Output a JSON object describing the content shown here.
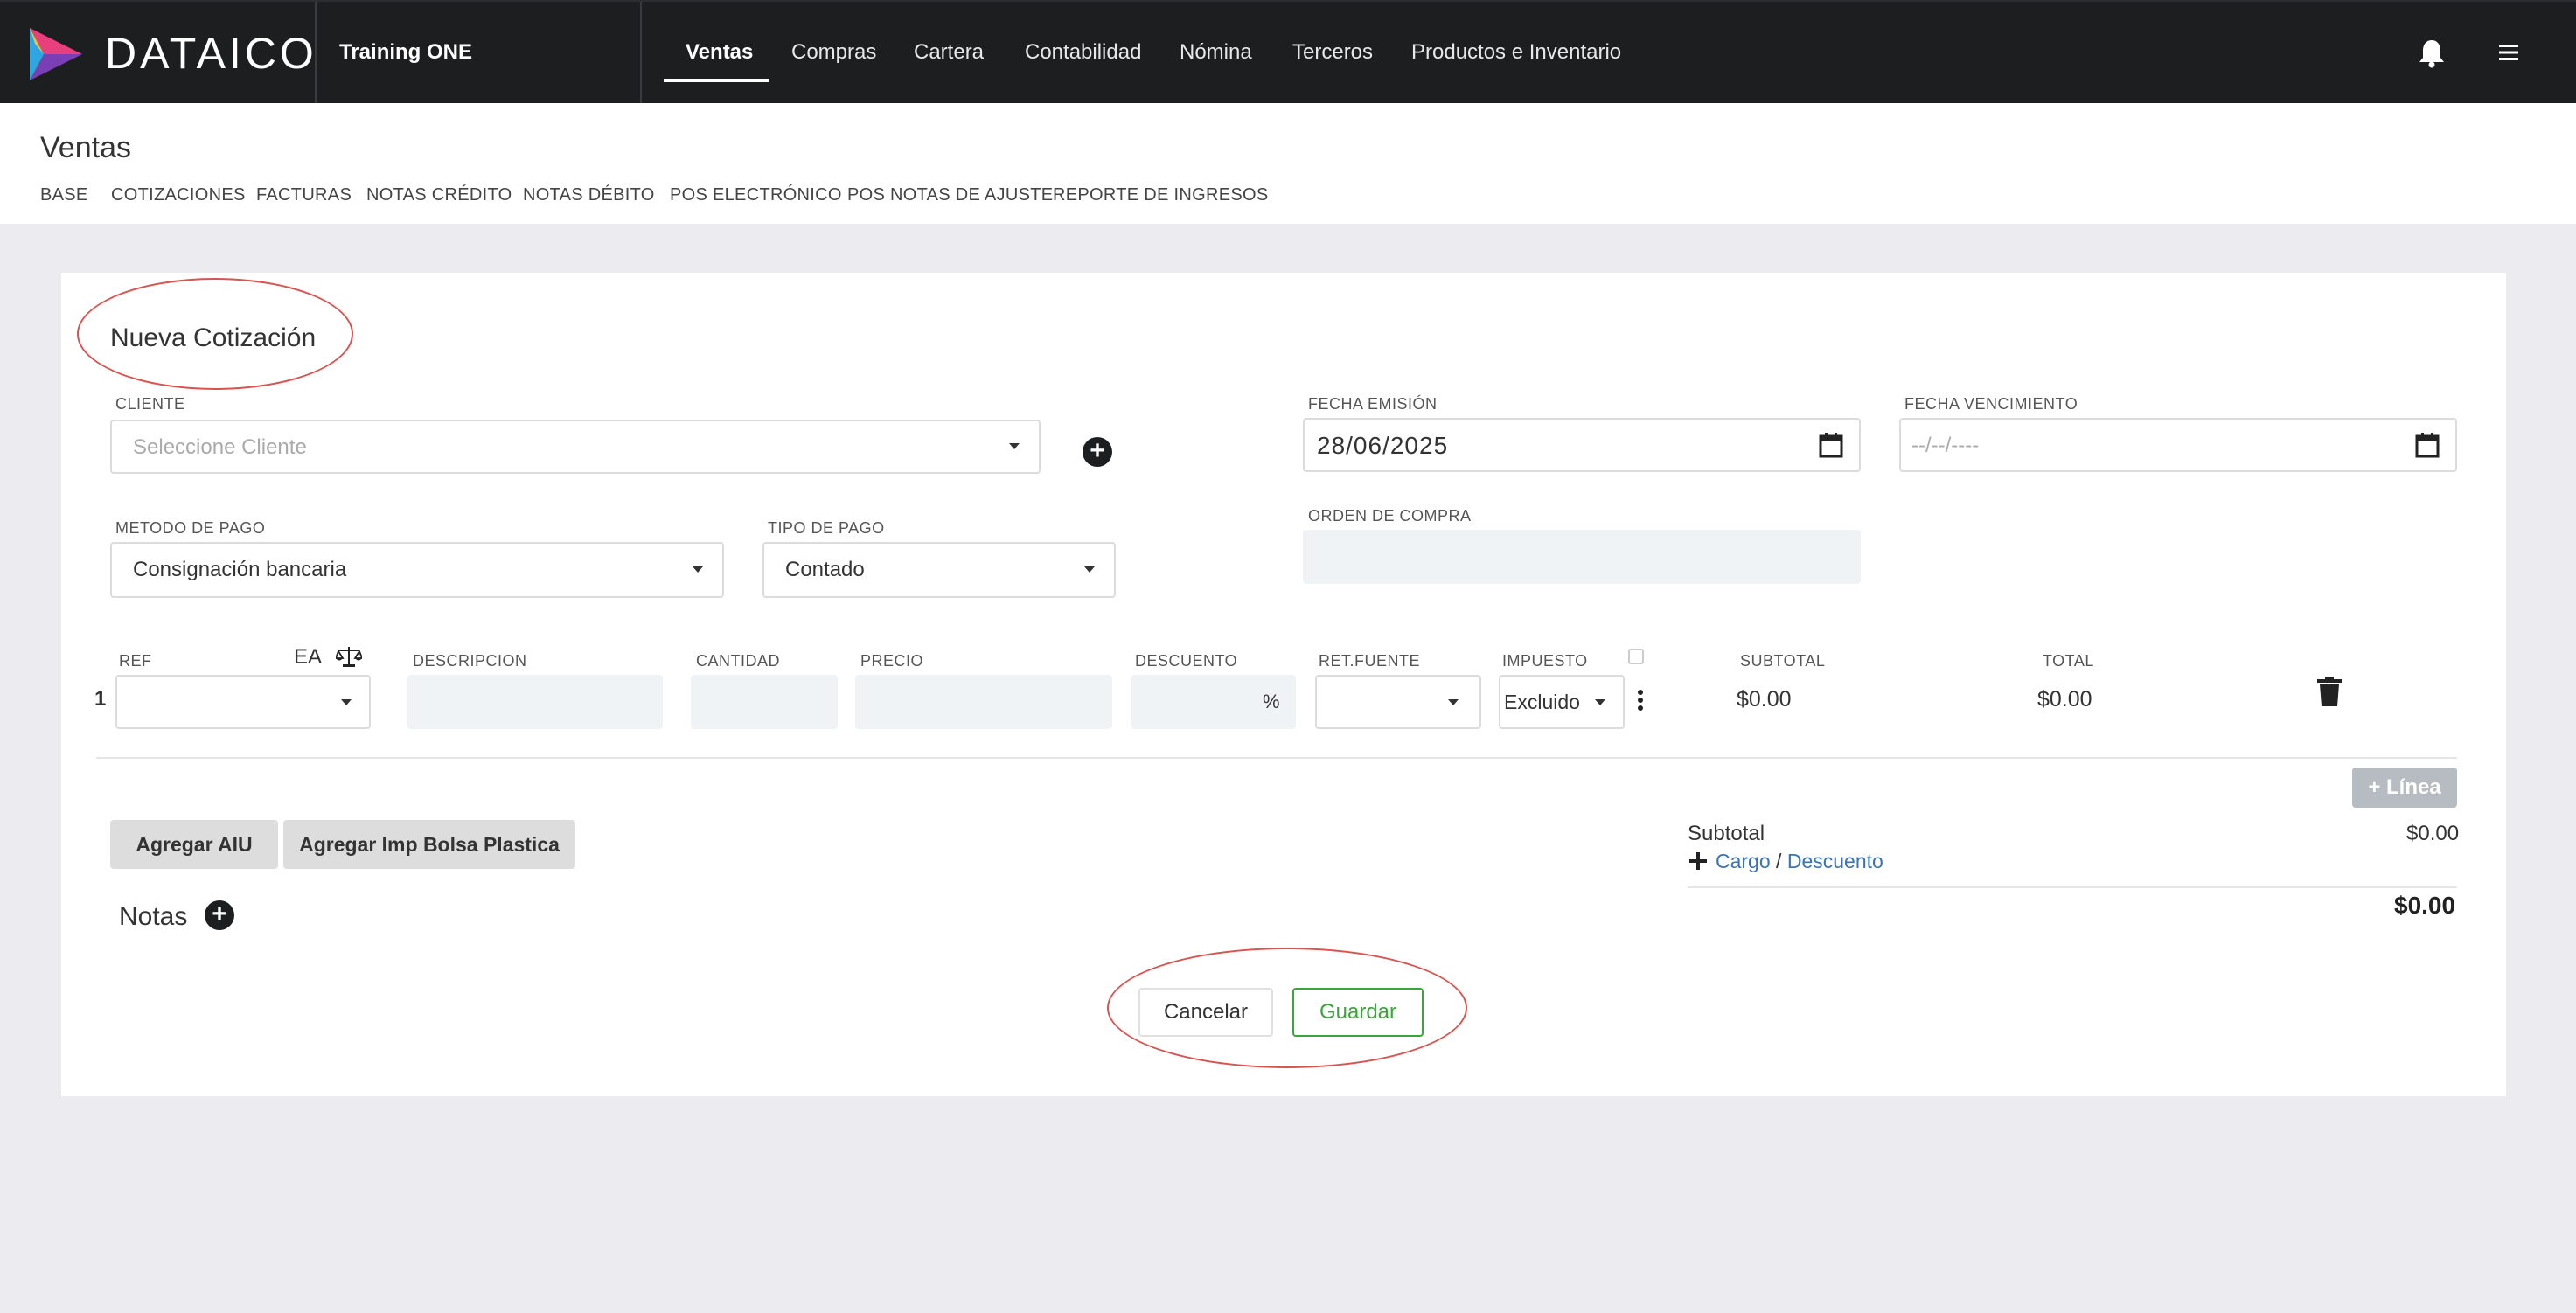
{
  "brand": {
    "name": "DATAICO",
    "company": "Training ONE"
  },
  "nav": {
    "items": [
      "Ventas",
      "Compras",
      "Cartera",
      "Contabilidad",
      "Nómina",
      "Terceros",
      "Productos e Inventario"
    ],
    "active": "Ventas"
  },
  "page": {
    "title": "Ventas",
    "tabs": [
      "BASE",
      "COTIZACIONES",
      "FACTURAS",
      "NOTAS CRÉDITO",
      "NOTAS DÉBITO",
      "POS ELECTRÓNICO",
      "POS NOTAS DE AJUSTE",
      "REPORTE DE INGRESOS"
    ]
  },
  "form": {
    "title": "Nueva Cotización",
    "cliente": {
      "label": "CLIENTE",
      "placeholder": "Seleccione Cliente"
    },
    "fecha_emision": {
      "label": "FECHA EMISIÓN",
      "value": "28/06/2025"
    },
    "fecha_vencimiento": {
      "label": "FECHA VENCIMIENTO",
      "value": "--/--/----"
    },
    "metodo_pago": {
      "label": "METODO DE PAGO",
      "value": "Consignación bancaria"
    },
    "tipo_pago": {
      "label": "TIPO DE PAGO",
      "value": "Contado"
    },
    "orden_compra": {
      "label": "ORDEN DE COMPRA",
      "value": ""
    }
  },
  "lines": {
    "headers": {
      "ref": "REF",
      "unit": "EA",
      "descripcion": "DESCRIPCION",
      "cantidad": "CANTIDAD",
      "precio": "PRECIO",
      "descuento": "DESCUENTO",
      "retfuente": "RET.FUENTE",
      "impuesto": "IMPUESTO",
      "subtotal": "SUBTOTAL",
      "total": "TOTAL"
    },
    "rows": [
      {
        "num": "1",
        "discount_unit": "%",
        "impuesto": "Excluido",
        "subtotal": "$0.00",
        "total": "$0.00"
      }
    ],
    "add_line": "+ Línea"
  },
  "actions": {
    "aiu": "Agregar AIU",
    "bolsa": "Agregar Imp Bolsa Plastica"
  },
  "notes": {
    "label": "Notas"
  },
  "totals": {
    "subtotal_label": "Subtotal",
    "subtotal_value": "$0.00",
    "cargo": "Cargo",
    "separator": "/",
    "descuento": "Descuento",
    "total_value": "$0.00"
  },
  "footer": {
    "cancel": "Cancelar",
    "save": "Guardar"
  },
  "colors": {
    "topbar": "#1d1e20",
    "accent_green": "#3aa53a",
    "link": "#3a73b8",
    "highlight_red": "#d9534f"
  }
}
